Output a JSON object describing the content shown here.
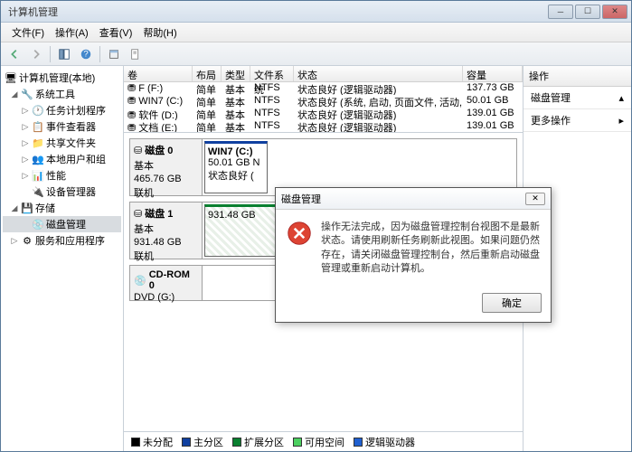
{
  "window": {
    "title": "计算机管理"
  },
  "menu": {
    "file": "文件(F)",
    "action": "操作(A)",
    "view": "查看(V)",
    "help": "帮助(H)"
  },
  "tree": {
    "root": "计算机管理(本地)",
    "systools": "系统工具",
    "tasksched": "任务计划程序",
    "eventvwr": "事件查看器",
    "sharedf": "共享文件夹",
    "localusers": "本地用户和组",
    "perf": "性能",
    "devmgr": "设备管理器",
    "storage": "存储",
    "diskmgmt": "磁盘管理",
    "services": "服务和应用程序"
  },
  "columns": {
    "vol": "卷",
    "layout": "布局",
    "type": "类型",
    "fs": "文件系统",
    "status": "状态",
    "capacity": "容量"
  },
  "volumes": [
    {
      "name": "F (F:)",
      "layout": "简单",
      "type": "基本",
      "fs": "NTFS",
      "status": "状态良好 (逻辑驱动器)",
      "cap": "137.73 GB"
    },
    {
      "name": "WIN7 (C:)",
      "layout": "简单",
      "type": "基本",
      "fs": "NTFS",
      "status": "状态良好 (系统, 启动, 页面文件, 活动, 故障转储, 主分区)",
      "cap": "50.01 GB"
    },
    {
      "name": "软件 (D:)",
      "layout": "简单",
      "type": "基本",
      "fs": "NTFS",
      "status": "状态良好 (逻辑驱动器)",
      "cap": "139.01 GB"
    },
    {
      "name": "文档 (E:)",
      "layout": "简单",
      "type": "基本",
      "fs": "NTFS",
      "status": "状态良好 (逻辑驱动器)",
      "cap": "139.01 GB"
    }
  ],
  "disks": {
    "d0": {
      "label": "磁盘 0",
      "type": "基本",
      "size": "465.76 GB",
      "state": "联机"
    },
    "d0p0": {
      "name": "WIN7  (C:)",
      "size": "50.01 GB N",
      "status": "状态良好 ("
    },
    "d1": {
      "label": "磁盘 1",
      "type": "基本",
      "size": "931.48 GB",
      "state": "联机"
    },
    "d1p0": {
      "size": "931.48 GB"
    },
    "cd": {
      "label": "CD-ROM 0",
      "sub": "DVD (G:)"
    }
  },
  "legend": {
    "unalloc": "未分配",
    "primary": "主分区",
    "ext": "扩展分区",
    "free": "可用空间",
    "logical": "逻辑驱动器"
  },
  "actions": {
    "header": "操作",
    "panel": "磁盘管理",
    "more": "更多操作"
  },
  "dialog": {
    "title": "磁盘管理",
    "text": "操作无法完成，因为磁盘管理控制台视图不是最新状态。请使用刷新任务刷新此视图。如果问题仍然存在，请关闭磁盘管理控制台，然后重新启动磁盘管理或重新启动计算机。",
    "ok": "确定"
  }
}
